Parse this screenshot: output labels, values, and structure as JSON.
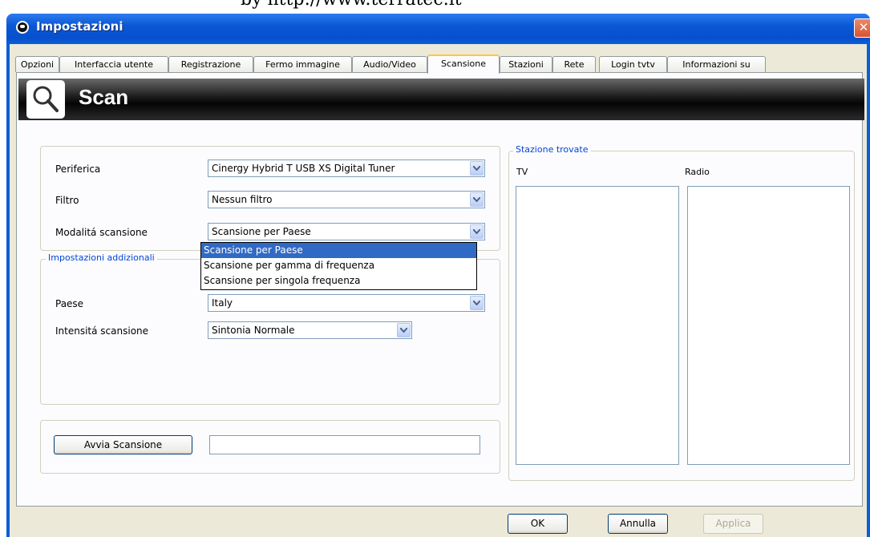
{
  "watermark": "by http://www.terratec.it",
  "window": {
    "title": "Impostazioni",
    "close_label": "✕"
  },
  "tabs": [
    {
      "label": "Opzioni"
    },
    {
      "label": "Interfaccia utente"
    },
    {
      "label": "Registrazione"
    },
    {
      "label": "Fermo immagine"
    },
    {
      "label": "Audio/Video"
    },
    {
      "label": "Scansione",
      "active": true
    },
    {
      "label": "Stazioni"
    },
    {
      "label": "Rete"
    },
    {
      "label": "Login tvtv"
    },
    {
      "label": "Informazioni su"
    }
  ],
  "banner": {
    "title": "Scan",
    "icon": "magnifier-icon"
  },
  "device_settings": {
    "periferica_label": "Periferica",
    "periferica_value": "Cinergy Hybrid T USB XS Digital Tuner",
    "filtro_label": "Filtro",
    "filtro_value": "Nessun filtro",
    "modalita_label": "Modalitá scansione",
    "modalita_value": "Scansione per Paese",
    "modalita_options": [
      "Scansione per Paese",
      "Scansione per gamma di frequenza",
      "Scansione per singola frequenza"
    ]
  },
  "additional": {
    "group_label": "Impostazioni addizionali",
    "paese_label": "Paese",
    "paese_value": "Italy",
    "intensita_label": "Intensitá scansione",
    "intensita_value": "Sintonia Normale"
  },
  "scan": {
    "button_label": "Avvia Scansione",
    "status_value": ""
  },
  "stations": {
    "group_label": "Stazione trovate",
    "tv_label": "TV",
    "radio_label": "Radio"
  },
  "footer": {
    "ok_label": "OK",
    "cancel_label": "Annulla",
    "apply_label": "Applica"
  },
  "colors": {
    "titlebar": "#0a57d4",
    "selection": "#316ac5",
    "group_label": "#0046d5",
    "active_tab_top": "#ffc83c"
  }
}
